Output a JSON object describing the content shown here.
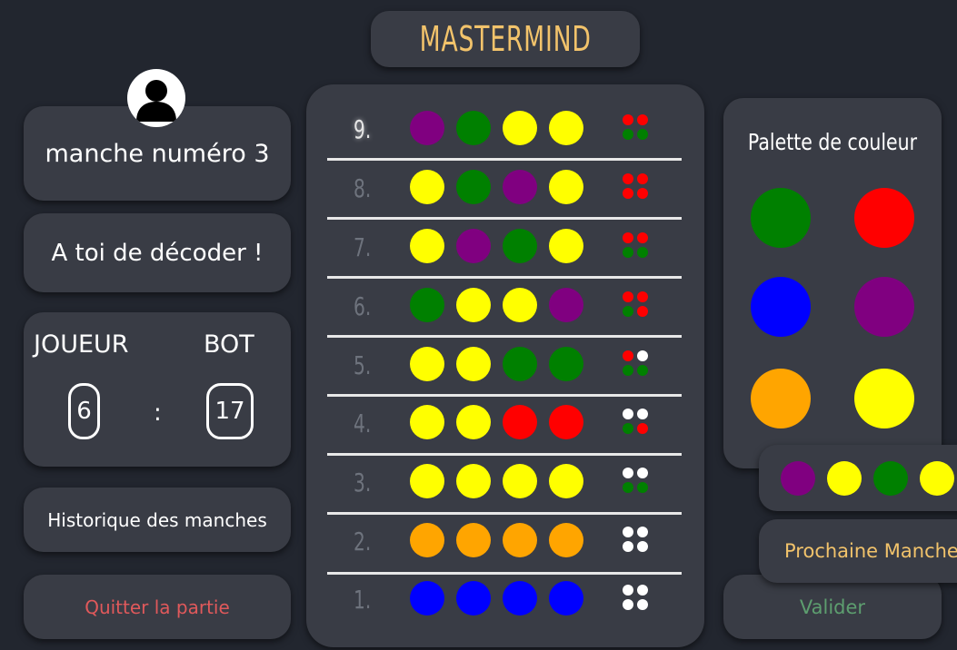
{
  "title": "MASTERMIND",
  "round_label": "manche numéro 3",
  "turn_message": "A toi de décoder !",
  "score": {
    "player_label": "JOUEUR",
    "bot_label": "BOT",
    "player_value": "6",
    "separator": ":",
    "bot_value": "17"
  },
  "history_label": "Historique des manches",
  "quit_label": "Quitter la partie",
  "palette_title": "Palette de couleur",
  "validate_label": "Valider",
  "next_round_label": "Prochaine Manche",
  "colors": {
    "purple": "#800080",
    "green": "#008000",
    "yellow": "#ffff00",
    "red": "#ff0000",
    "blue": "#0000ff",
    "orange": "#ffa500",
    "white": "#ffffff",
    "accent": "#f2c36b"
  },
  "palette": [
    "green",
    "red",
    "blue",
    "purple",
    "orange",
    "yellow"
  ],
  "secret_code": [
    "purple",
    "yellow",
    "green",
    "yellow"
  ],
  "board": [
    {
      "number": "9.",
      "active": true,
      "pegs": [
        "purple",
        "green",
        "yellow",
        "yellow"
      ],
      "hints": [
        "red",
        "red",
        "green",
        "green"
      ]
    },
    {
      "number": "8.",
      "active": false,
      "pegs": [
        "yellow",
        "green",
        "purple",
        "yellow"
      ],
      "hints": [
        "red",
        "red",
        "red",
        "red"
      ]
    },
    {
      "number": "7.",
      "active": false,
      "pegs": [
        "yellow",
        "purple",
        "green",
        "yellow"
      ],
      "hints": [
        "red",
        "red",
        "green",
        "green"
      ]
    },
    {
      "number": "6.",
      "active": false,
      "pegs": [
        "green",
        "yellow",
        "yellow",
        "purple"
      ],
      "hints": [
        "red",
        "red",
        "green",
        "red"
      ]
    },
    {
      "number": "5.",
      "active": false,
      "pegs": [
        "yellow",
        "yellow",
        "green",
        "green"
      ],
      "hints": [
        "red",
        "white",
        "green",
        "green"
      ]
    },
    {
      "number": "4.",
      "active": false,
      "pegs": [
        "yellow",
        "yellow",
        "red",
        "red"
      ],
      "hints": [
        "white",
        "white",
        "green",
        "red"
      ]
    },
    {
      "number": "3.",
      "active": false,
      "pegs": [
        "yellow",
        "yellow",
        "yellow",
        "yellow"
      ],
      "hints": [
        "white",
        "white",
        "green",
        "green"
      ]
    },
    {
      "number": "2.",
      "active": false,
      "pegs": [
        "orange",
        "orange",
        "orange",
        "orange"
      ],
      "hints": [
        "white",
        "white",
        "white",
        "white"
      ]
    },
    {
      "number": "1.",
      "active": false,
      "pegs": [
        "blue",
        "blue",
        "blue",
        "blue"
      ],
      "hints": [
        "white",
        "white",
        "white",
        "white"
      ]
    }
  ]
}
